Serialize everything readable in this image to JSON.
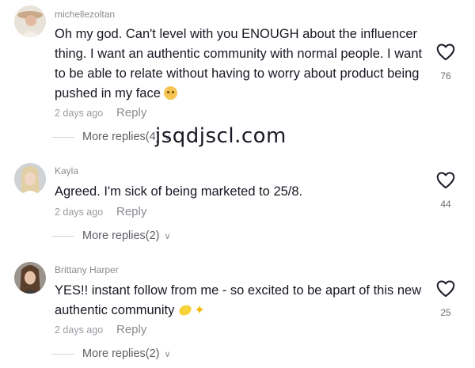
{
  "comments": [
    {
      "username": "michellezoltan",
      "text": "Oh my god. Can't level with you ENOUGH about the influencer thing. I want an authentic community with normal people. I want to be able to relate without having to worry about product being pushed in my face",
      "emoji": "face-emoji",
      "date": "2 days ago",
      "reply_label": "Reply",
      "more_replies": "More replies(4)",
      "likes": "76"
    },
    {
      "username": "Kayla",
      "text": "Agreed. I'm sick of being marketed to 25/8.",
      "date": "2 days ago",
      "reply_label": "Reply",
      "more_replies": "More replies(2)",
      "likes": "44"
    },
    {
      "username": "Brittany Harper",
      "text": "YES!! instant follow from me - so excited to be apart of this new authentic community",
      "emoji": "lemon-sparkle-emoji",
      "date": "2 days ago",
      "reply_label": "Reply",
      "more_replies": "More replies(2)",
      "likes": "25"
    }
  ],
  "watermark": "jsqdjscl.com",
  "icons": {
    "like": "heart-icon",
    "expand": "chevron-down-icon"
  },
  "colors": {
    "text": "#161823",
    "muted": "#8a8b91",
    "background": "#ffffff"
  }
}
